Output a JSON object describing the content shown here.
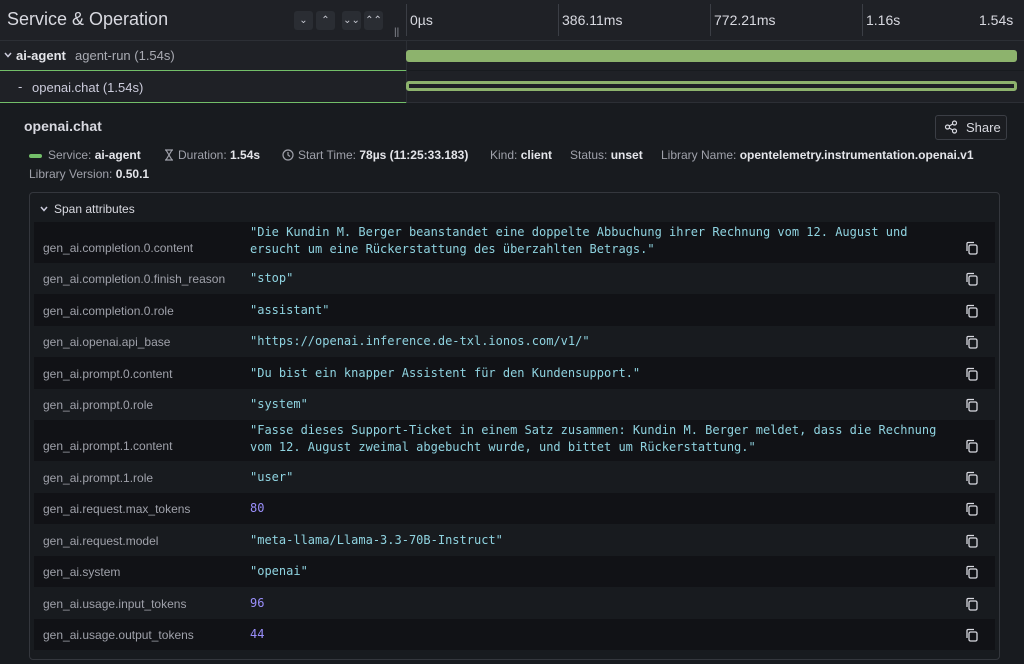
{
  "header": {
    "title": "Service & Operation",
    "controls": [
      "⌄",
      "⌃",
      "⌄⌄",
      "⌃⌃"
    ],
    "resizer": "||",
    "ticks": [
      "0µs",
      "386.11ms",
      "772.21ms",
      "1.16s",
      "1.54s"
    ]
  },
  "rows": [
    {
      "service": "ai-agent",
      "operation": "agent-run (1.54s)"
    },
    {
      "service": "-",
      "operation": "openai.chat (1.54s)"
    }
  ],
  "detail": {
    "title": "openai.chat",
    "share_label": "Share",
    "meta": {
      "service_label": "Service:",
      "service": "ai-agent",
      "duration_label": "Duration:",
      "duration": "1.54s",
      "start_label": "Start Time:",
      "start": "78µs (11:25:33.183)",
      "kind_label": "Kind:",
      "kind": "client",
      "status_label": "Status:",
      "status": "unset",
      "library_label": "Library Name:",
      "library": "opentelemetry.instrumentation.openai.v1",
      "version_label": "Library Version:",
      "version": "0.50.1"
    },
    "attributes_title": "Span attributes",
    "attributes": [
      {
        "key": "gen_ai.completion.0.content",
        "value": "\"Die Kundin M. Berger beanstandet eine doppelte Abbuchung ihrer Rechnung vom 12. August und ersucht um eine Rückerstattung des überzahlten Betrags.\""
      },
      {
        "key": "gen_ai.completion.0.finish_reason",
        "value": "\"stop\""
      },
      {
        "key": "gen_ai.completion.0.role",
        "value": "\"assistant\""
      },
      {
        "key": "gen_ai.openai.api_base",
        "value": "\"https://openai.inference.de-txl.ionos.com/v1/\""
      },
      {
        "key": "gen_ai.prompt.0.content",
        "value": "\"Du bist ein knapper Assistent für den Kundensupport.\""
      },
      {
        "key": "gen_ai.prompt.0.role",
        "value": "\"system\""
      },
      {
        "key": "gen_ai.prompt.1.content",
        "value": "\"Fasse dieses Support-Ticket in einem Satz zusammen: Kundin M. Berger meldet, dass die Rechnung vom 12. August zweimal abgebucht wurde, und bittet um Rückerstattung.\""
      },
      {
        "key": "gen_ai.prompt.1.role",
        "value": "\"user\""
      },
      {
        "key": "gen_ai.request.max_tokens",
        "value": "80"
      },
      {
        "key": "gen_ai.request.model",
        "value": "\"meta-llama/Llama-3.3-70B-Instruct\""
      },
      {
        "key": "gen_ai.system",
        "value": "\"openai\""
      },
      {
        "key": "gen_ai.usage.input_tokens",
        "value": "96"
      },
      {
        "key": "gen_ai.usage.output_tokens",
        "value": "44"
      }
    ]
  },
  "colors": {
    "accent": "#73bf69",
    "bar": "#8db36d",
    "string_value": "#8fd3e0",
    "number_value": "#9a8ffb"
  }
}
